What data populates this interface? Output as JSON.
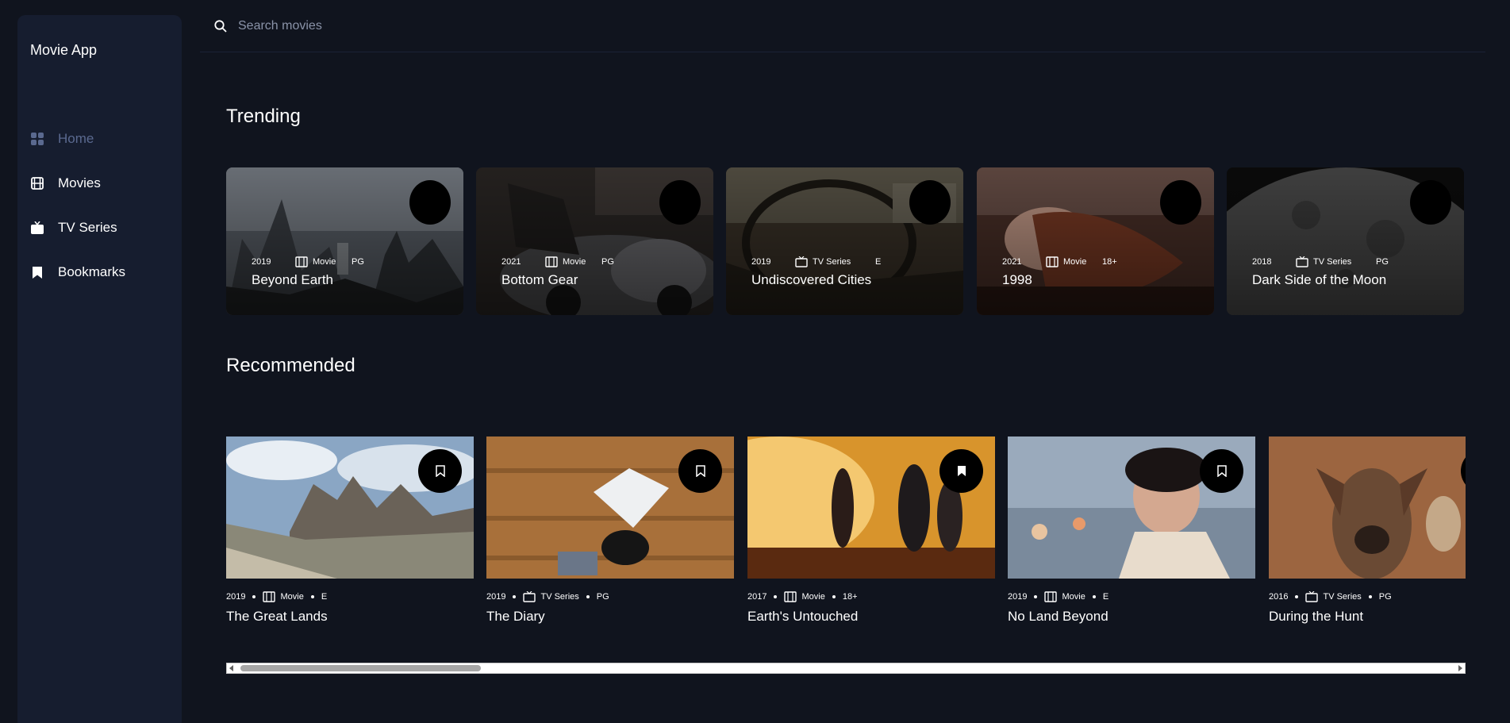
{
  "app": {
    "title": "Movie App"
  },
  "search": {
    "placeholder": "Search movies"
  },
  "nav": {
    "items": [
      {
        "label": "Home",
        "icon": "grid-icon",
        "active": true
      },
      {
        "label": "Movies",
        "icon": "film-icon",
        "active": false
      },
      {
        "label": "TV Series",
        "icon": "tv-icon",
        "active": false
      },
      {
        "label": "Bookmarks",
        "icon": "bookmark-icon",
        "active": false
      }
    ]
  },
  "colors": {
    "background": "#10141e",
    "sidebar": "#161d2f",
    "inactive_text": "#5a698f",
    "accent_white": "#ffffff"
  },
  "trending": {
    "title": "Trending",
    "items": [
      {
        "year": "2019",
        "category": "Movie",
        "rating": "PG",
        "title": "Beyond Earth"
      },
      {
        "year": "2021",
        "category": "Movie",
        "rating": "PG",
        "title": "Bottom Gear"
      },
      {
        "year": "2019",
        "category": "TV Series",
        "rating": "E",
        "title": "Undiscovered Cities"
      },
      {
        "year": "2021",
        "category": "Movie",
        "rating": "18+",
        "title": "1998"
      },
      {
        "year": "2018",
        "category": "TV Series",
        "rating": "PG",
        "title": "Dark Side of the Moon"
      }
    ]
  },
  "recommended": {
    "title": "Recommended",
    "items": [
      {
        "year": "2019",
        "category": "Movie",
        "rating": "E",
        "title": "The Great Lands",
        "bookmarked": false
      },
      {
        "year": "2019",
        "category": "TV Series",
        "rating": "PG",
        "title": "The Diary",
        "bookmarked": false
      },
      {
        "year": "2017",
        "category": "Movie",
        "rating": "18+",
        "title": "Earth's Untouched",
        "bookmarked": true
      },
      {
        "year": "2019",
        "category": "Movie",
        "rating": "E",
        "title": "No Land Beyond",
        "bookmarked": false
      },
      {
        "year": "2016",
        "category": "TV Series",
        "rating": "PG",
        "title": "During the Hunt",
        "bookmarked": false
      }
    ]
  }
}
